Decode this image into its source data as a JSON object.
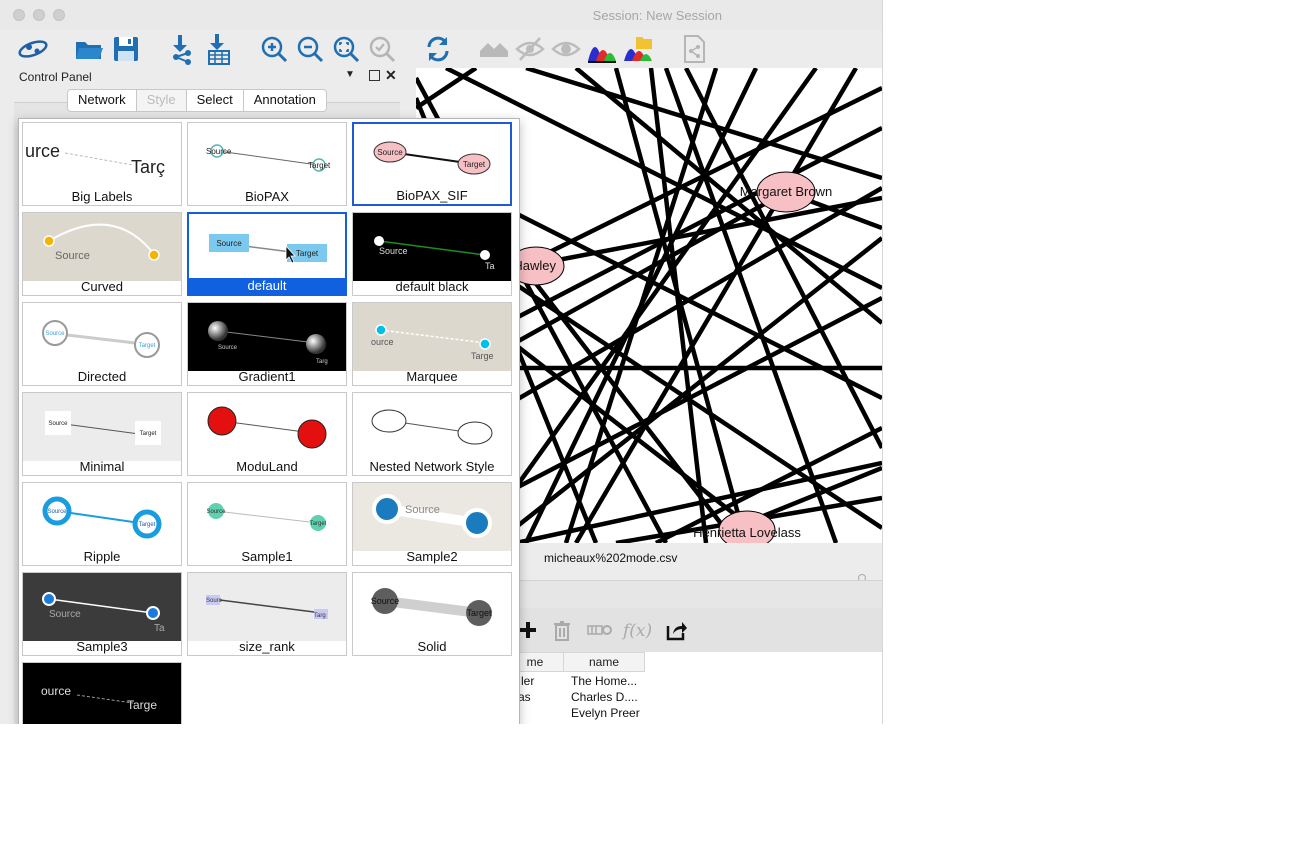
{
  "window": {
    "title": "Session: New Session"
  },
  "control_panel": {
    "title": "Control Panel",
    "tabs": [
      {
        "label": "Network"
      },
      {
        "label": "Style",
        "active": true
      },
      {
        "label": "Select"
      },
      {
        "label": "Annotation"
      }
    ]
  },
  "styles": [
    {
      "label": "Big Labels",
      "preview": {
        "source": "urce",
        "target": "Tarç"
      }
    },
    {
      "label": "BioPAX",
      "preview": {
        "source": "Source",
        "target": "Target"
      }
    },
    {
      "label": "BioPAX_SIF",
      "preview": {
        "source": "Source",
        "target": "Target"
      },
      "selected": true
    },
    {
      "label": "Curved",
      "preview": {
        "source": "Source"
      }
    },
    {
      "label": "default",
      "preview": {
        "source": "Source",
        "target": "Target"
      },
      "highlighted": true
    },
    {
      "label": "default black",
      "preview": {
        "source": "Source",
        "target": "Ta"
      }
    },
    {
      "label": "Directed",
      "preview": {
        "source": "Source",
        "target": "Target"
      }
    },
    {
      "label": "Gradient1",
      "preview": {
        "source": "Source",
        "target": "Targ"
      }
    },
    {
      "label": "Marquee",
      "preview": {
        "source": "ource",
        "target": "Targe"
      }
    },
    {
      "label": "Minimal",
      "preview": {
        "source": "Source",
        "target": "Target"
      }
    },
    {
      "label": "ModuLand"
    },
    {
      "label": "Nested Network Style"
    },
    {
      "label": "Ripple",
      "preview": {
        "source": "Source",
        "target": "Target"
      }
    },
    {
      "label": "Sample1",
      "preview": {
        "source": "Source",
        "target": "Target"
      }
    },
    {
      "label": "Sample2",
      "preview": {
        "source": "Source"
      }
    },
    {
      "label": "Sample3",
      "preview": {
        "source": "Source",
        "target": "Ta"
      }
    },
    {
      "label": "size_rank",
      "preview": {
        "source": "Sourc",
        "target": "Targ"
      }
    },
    {
      "label": "Solid",
      "preview": {
        "source": "Source",
        "target": "Target"
      }
    },
    {
      "label": "",
      "preview": {
        "source": "ource",
        "target": "Targe"
      }
    }
  ],
  "network_nodes": {
    "margaret": "Margaret Brown",
    "hawley": "Hawley",
    "henrietta": "Henrietta Lovelass"
  },
  "table": {
    "name": "micheaux%202mode.csv",
    "columns": [
      "me",
      "name"
    ],
    "rows": [
      [
        "ler",
        "The Home..."
      ],
      [
        "as",
        "Charles D...."
      ],
      [
        "",
        "Evelyn Preer"
      ]
    ]
  },
  "colors": {
    "selection_blue": "#1160e0",
    "node_pink": "#f6c0c4"
  }
}
